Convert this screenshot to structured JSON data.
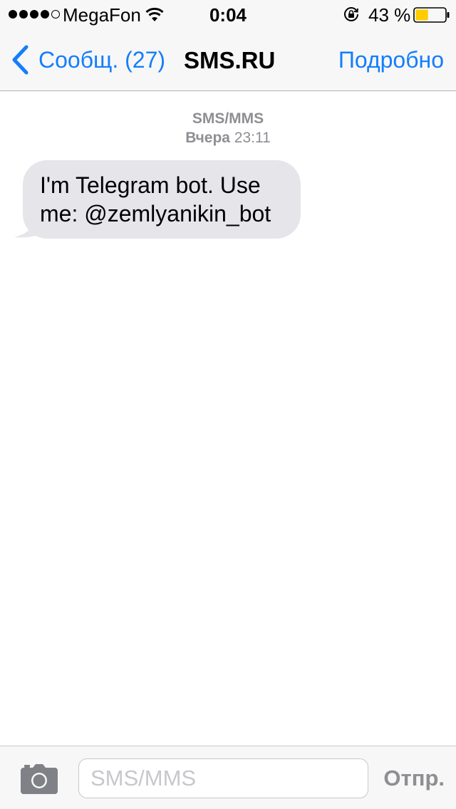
{
  "status_bar": {
    "signal_bars_filled": 4,
    "signal_bars_total": 5,
    "carrier": "MegaFon",
    "wifi_icon": "wifi-icon",
    "time": "0:04",
    "lock_icon": "rotation-lock-icon",
    "battery_percent_label": "43 %",
    "battery_level": 0.43,
    "battery_color": "#ffcc00"
  },
  "nav": {
    "back_label": "Сообщ. (27)",
    "title": "SMS.RU",
    "details_label": "Подробно",
    "accent_color": "#147efb"
  },
  "conversation": {
    "service_label": "SMS/MMS",
    "date_day": "Вчера",
    "date_time": "23:11",
    "messages": [
      {
        "direction": "incoming",
        "text": "I'm Telegram bot. Use\nme: @zemlyanikin_bot",
        "bubble_color": "#e5e5ea"
      }
    ]
  },
  "input_bar": {
    "camera_icon": "camera-icon",
    "placeholder": "SMS/MMS",
    "value": "",
    "send_label": "Отпр."
  }
}
